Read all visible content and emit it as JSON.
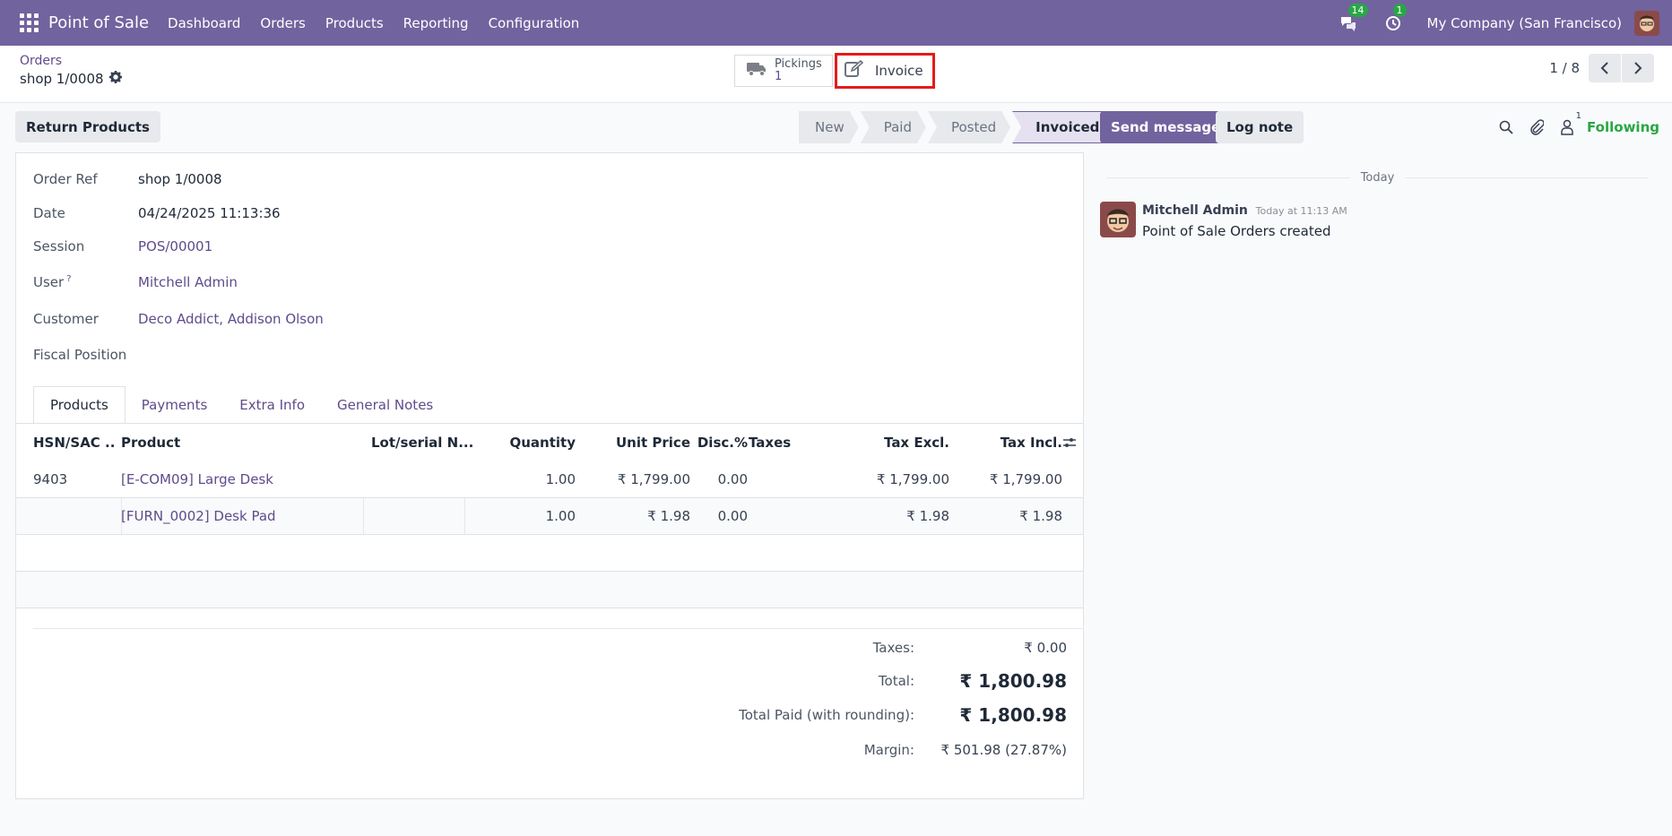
{
  "navbar": {
    "app_title": "Point of Sale",
    "menu": [
      "Dashboard",
      "Orders",
      "Products",
      "Reporting",
      "Configuration"
    ],
    "messages_badge": "14",
    "activities_badge": "1",
    "company": "My Company (San Francisco)"
  },
  "control": {
    "breadcrumb_parent": "Orders",
    "breadcrumb_current": "shop 1/0008",
    "pickings_label": "Pickings",
    "pickings_count": "1",
    "invoice_label": "Invoice",
    "pager": "1 / 8"
  },
  "actions": {
    "return_products": "Return Products"
  },
  "statusbar": {
    "stages": [
      "New",
      "Paid",
      "Posted",
      "Invoiced"
    ],
    "active_stage": "Invoiced"
  },
  "form": {
    "fields": {
      "order_ref": {
        "label": "Order Ref",
        "value": "shop 1/0008"
      },
      "date": {
        "label": "Date",
        "value": "04/24/2025 11:13:36"
      },
      "session": {
        "label": "Session",
        "value": "POS/00001"
      },
      "user": {
        "label": "User",
        "help": "?",
        "value": "Mitchell Admin"
      },
      "customer": {
        "label": "Customer",
        "value": "Deco Addict, Addison Olson"
      },
      "fiscal_position": {
        "label": "Fiscal Position",
        "value": ""
      }
    },
    "tabs": [
      "Products",
      "Payments",
      "Extra Info",
      "General Notes"
    ],
    "table": {
      "headers": {
        "hsn": "HSN/SAC ...",
        "product": "Product",
        "lot": "Lot/serial N...",
        "qty": "Quantity",
        "unit_price": "Unit Price",
        "disc": "Disc.%",
        "taxes": "Taxes",
        "tax_excl": "Tax Excl.",
        "tax_incl": "Tax Incl."
      },
      "rows": [
        {
          "hsn": "9403",
          "product": "[E-COM09] Large Desk",
          "lot": "",
          "qty": "1.00",
          "unit_price": "₹ 1,799.00",
          "disc": "0.00",
          "taxes": "",
          "tax_excl": "₹ 1,799.00",
          "tax_incl": "₹ 1,799.00"
        },
        {
          "hsn": "",
          "product": "[FURN_0002] Desk Pad",
          "lot": "",
          "qty": "1.00",
          "unit_price": "₹ 1.98",
          "disc": "0.00",
          "taxes": "",
          "tax_excl": "₹ 1.98",
          "tax_incl": "₹ 1.98"
        }
      ]
    },
    "totals": {
      "taxes": {
        "label": "Taxes:",
        "value": "₹ 0.00"
      },
      "total": {
        "label": "Total:",
        "value": "₹ 1,800.98"
      },
      "total_paid": {
        "label": "Total Paid (with rounding):",
        "value": "₹ 1,800.98"
      },
      "margin": {
        "label": "Margin:",
        "value": "₹ 501.98 (27.87%)"
      }
    }
  },
  "chatter": {
    "send_message": "Send message",
    "log_note": "Log note",
    "followers_count": "1",
    "following": "Following",
    "date_separator": "Today",
    "message": {
      "author": "Mitchell Admin",
      "time": "Today at 11:13 AM",
      "body": "Point of Sale Orders created"
    }
  },
  "colors": {
    "navbar": "#71639e",
    "link": "#5f4b8b",
    "following": "#28a745",
    "highlight_border": "#e41b1b"
  }
}
